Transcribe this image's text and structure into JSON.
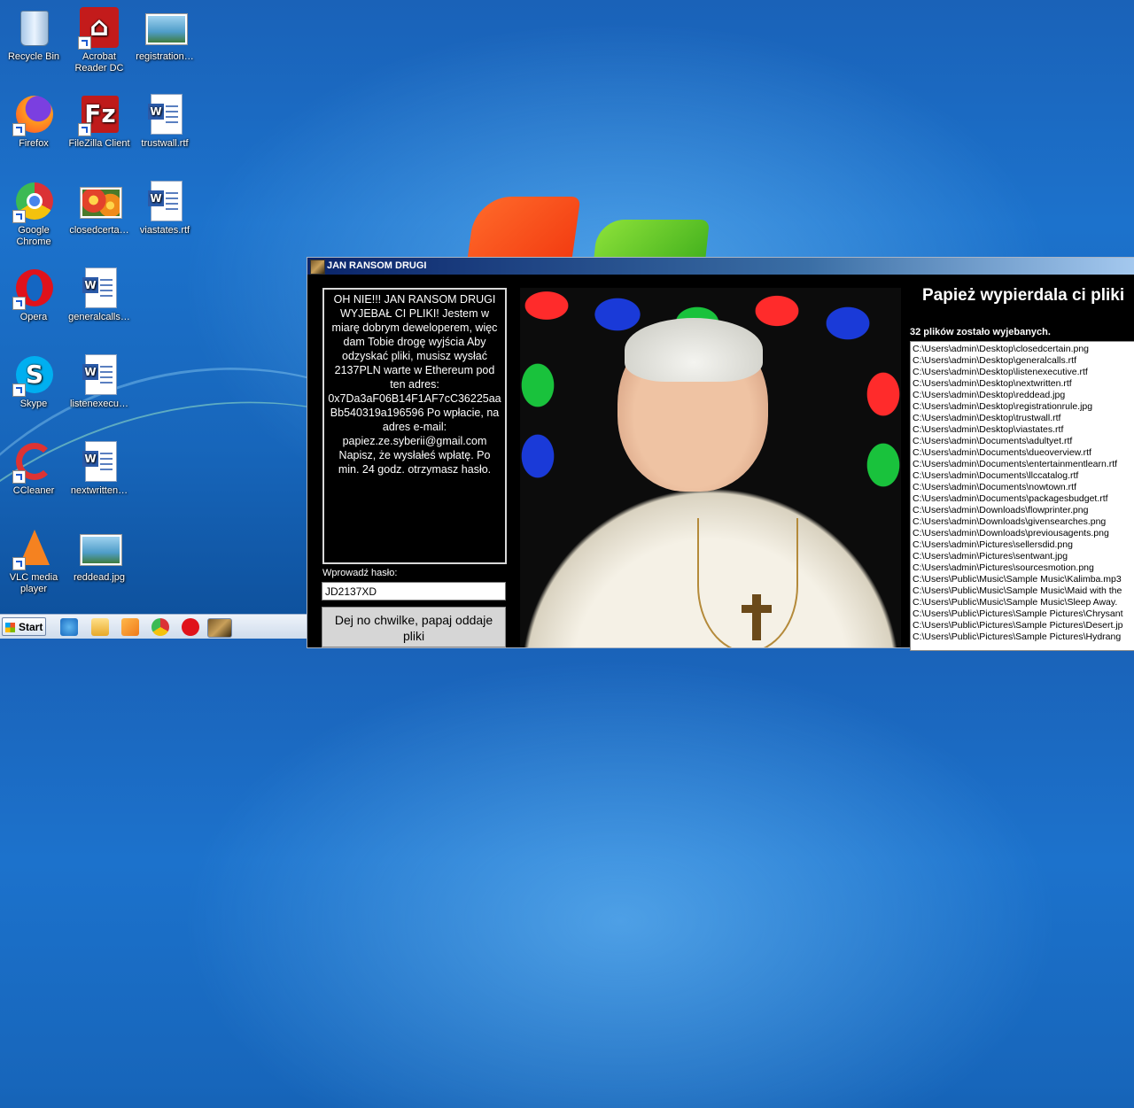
{
  "desktop": {
    "icons": [
      {
        "label": "Recycle Bin",
        "icon": "recycle-bin-icon"
      },
      {
        "label": "Acrobat Reader DC",
        "icon": "acrobat-icon"
      },
      {
        "label": "registration…",
        "icon": "image-file-icon"
      },
      {
        "label": "Firefox",
        "icon": "firefox-icon"
      },
      {
        "label": "FileZilla Client",
        "icon": "filezilla-icon"
      },
      {
        "label": "trustwall.rtf",
        "icon": "word-document-icon"
      },
      {
        "label": "Google Chrome",
        "icon": "chrome-icon"
      },
      {
        "label": "closedcerta…",
        "icon": "image-file-icon"
      },
      {
        "label": "viastates.rtf",
        "icon": "word-document-icon"
      },
      {
        "label": "Opera",
        "icon": "opera-icon"
      },
      {
        "label": "generalcalls…",
        "icon": "word-document-icon"
      },
      {
        "label": "Skype",
        "icon": "skype-icon"
      },
      {
        "label": "listenexecu…",
        "icon": "word-document-icon"
      },
      {
        "label": "CCleaner",
        "icon": "ccleaner-icon"
      },
      {
        "label": "nextwritten…",
        "icon": "word-document-icon"
      },
      {
        "label": "VLC media player",
        "icon": "vlc-icon"
      },
      {
        "label": "reddead.jpg",
        "icon": "image-file-icon"
      }
    ]
  },
  "ransom_window": {
    "title": "JAN RANSOM DRUGI",
    "message": "OH NIE!!! JAN RANSOM DRUGI WYJEBAŁ CI PLIKI! Jestem w miarę dobrym deweloperem, więc dam Tobie drogę wyjścia Aby odzyskać pliki, musisz wysłać 2137PLN warte w Ethereum pod ten adres: 0x7Da3aF06B14F1AF7cC36225aaBb540319a196596 Po wpłacie, na adres e-mail: papiez.ze.syberii@gmail.com Napisz, że wysłałeś wpłatę. Po min. 24 godz. otrzymasz hasło.",
    "password_label": "Wprowadź hasło:",
    "password_value": "JD2137XD",
    "button_label": "Dej no chwilke, papaj oddaje pliki",
    "heading": "Papież wypierdala ci pliki",
    "files_count_text": "32 plików zostało wyjebanych.",
    "files": [
      "C:\\Users\\admin\\Desktop\\closedcertain.png",
      "C:\\Users\\admin\\Desktop\\generalcalls.rtf",
      "C:\\Users\\admin\\Desktop\\listenexecutive.rtf",
      "C:\\Users\\admin\\Desktop\\nextwritten.rtf",
      "C:\\Users\\admin\\Desktop\\reddead.jpg",
      "C:\\Users\\admin\\Desktop\\registrationrule.jpg",
      "C:\\Users\\admin\\Desktop\\trustwall.rtf",
      "C:\\Users\\admin\\Desktop\\viastates.rtf",
      "C:\\Users\\admin\\Documents\\adultyet.rtf",
      "C:\\Users\\admin\\Documents\\dueoverview.rtf",
      "C:\\Users\\admin\\Documents\\entertainmentlearn.rtf",
      "C:\\Users\\admin\\Documents\\llccatalog.rtf",
      "C:\\Users\\admin\\Documents\\nowtown.rtf",
      "C:\\Users\\admin\\Documents\\packagesbudget.rtf",
      "C:\\Users\\admin\\Downloads\\flowprinter.png",
      "C:\\Users\\admin\\Downloads\\givensearches.png",
      "C:\\Users\\admin\\Downloads\\previousagents.png",
      "C:\\Users\\admin\\Pictures\\sellersdid.png",
      "C:\\Users\\admin\\Pictures\\sentwant.jpg",
      "C:\\Users\\admin\\Pictures\\sourcesmotion.png",
      "C:\\Users\\Public\\Music\\Sample Music\\Kalimba.mp3",
      "C:\\Users\\Public\\Music\\Sample Music\\Maid with the",
      "C:\\Users\\Public\\Music\\Sample Music\\Sleep Away.",
      "C:\\Users\\Public\\Pictures\\Sample Pictures\\Chrysant",
      "C:\\Users\\Public\\Pictures\\Sample Pictures\\Desert.jp",
      "C:\\Users\\Public\\Pictures\\Sample Pictures\\Hydrang"
    ]
  },
  "taskbar": {
    "start_label": "Start",
    "pinned": [
      "internet-explorer-icon",
      "file-explorer-icon",
      "media-player-icon",
      "chrome-icon",
      "opera-icon",
      "jan-ransom-icon"
    ]
  }
}
